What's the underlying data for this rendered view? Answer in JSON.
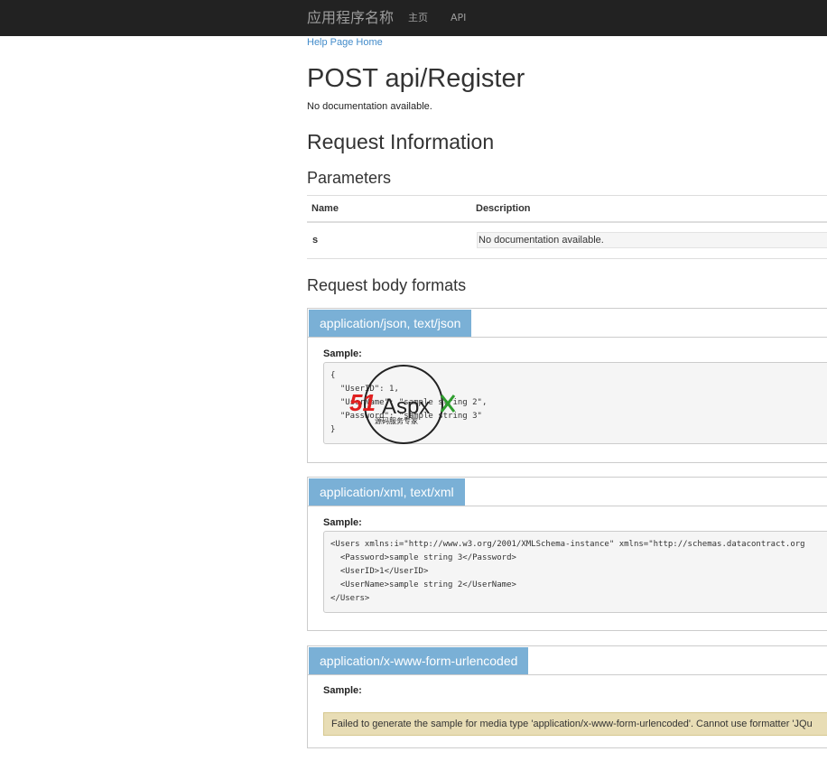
{
  "navbar": {
    "brand": "应用程序名称",
    "links": [
      "主页",
      "API"
    ]
  },
  "breadcrumb": {
    "home_link": "Help Page Home"
  },
  "page": {
    "title": "POST api/Register",
    "description": "No documentation available.",
    "request_info_heading": "Request Information",
    "parameters_heading": "Parameters",
    "parameters_table": {
      "headers": [
        "Name",
        "Description"
      ],
      "rows": [
        {
          "name": "s",
          "description": "No documentation available."
        }
      ]
    },
    "request_body_heading": "Request body formats"
  },
  "formats": [
    {
      "tab": "application/json, text/json",
      "sample_label": "Sample:",
      "lines": [
        "{",
        "  \"UserID\": 1,",
        "  \"UserName\": \"sample string 2\",",
        "  \"Password\": \"sample string 3\"",
        "}"
      ]
    },
    {
      "tab": "application/xml, text/xml",
      "sample_label": "Sample:",
      "lines": [
        "<Users xmlns:i=\"http://www.w3.org/2001/XMLSchema-instance\" xmlns=\"http://schemas.datacontract.org",
        "  <Password>sample string 3</Password>",
        "  <UserID>1</UserID>",
        "  <UserName>sample string 2</UserName>",
        "</Users>"
      ]
    },
    {
      "tab": "application/x-www-form-urlencoded",
      "sample_label": "Sample:",
      "warning": "Failed to generate the sample for media type 'application/x-www-form-urlencoded'. Cannot use formatter 'JQu"
    }
  ],
  "watermark": {
    "brand_red": "51",
    "brand_black": "Aspx",
    "tagline": "源码服务专家",
    "red_color": "#e02020",
    "green_color": "#2e9e2e"
  }
}
